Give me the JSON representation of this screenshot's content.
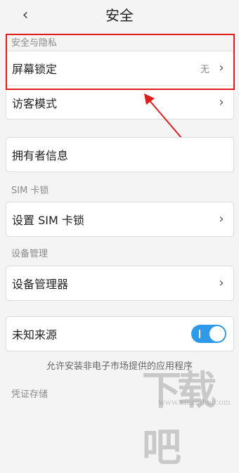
{
  "header": {
    "title": "安全",
    "back_icon": "‹"
  },
  "sections": {
    "security_privacy": "安全与隐私",
    "sim_lock": "SIM 卡锁",
    "device_management": "设备管理",
    "credential_storage": "凭证存储"
  },
  "rows": {
    "screen_lock": {
      "label": "屏幕锁定",
      "value": "无"
    },
    "guest_mode": {
      "label": "访客模式"
    },
    "owner_info": {
      "label": "拥有者信息"
    },
    "set_sim_lock": {
      "label": "设置 SIM 卡锁"
    },
    "device_admins": {
      "label": "设备管理器"
    },
    "unknown_sources": {
      "label": "未知来源",
      "toggle_on": true
    }
  },
  "notes": {
    "unknown_sources_desc": "允许安装非电子市场提供的应用程序"
  },
  "annotation": {
    "highlight_color": "#e01c1c",
    "arrow_color": "#e01c1c"
  },
  "watermark": {
    "text": "下载吧",
    "url": "www.xiazaiba.com"
  },
  "colors": {
    "toggle_accent": "#2f9be8"
  }
}
